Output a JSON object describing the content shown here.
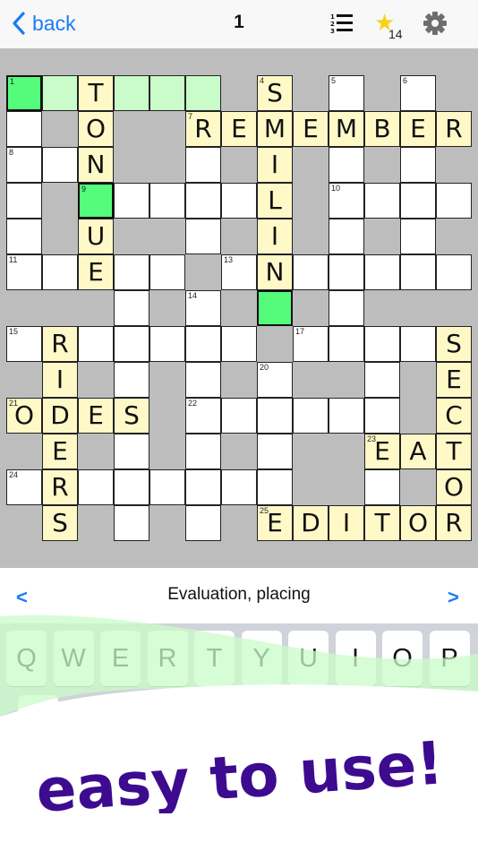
{
  "topbar": {
    "back_label": "back",
    "puzzle_number": "1",
    "star_count": "14",
    "icons": {
      "back": "chevron-left-icon",
      "clue_list": "numbered-list-icon",
      "star": "star-icon",
      "settings": "gear-icon"
    }
  },
  "colors": {
    "accent": "#1a7cf5",
    "board_bg": "#bdbdbd",
    "filled_cell": "#fff9c8",
    "selected_word": "#c9fcc8",
    "active_cell": "#55fc7c",
    "star": "#f7d21a",
    "tagline": "#3d0b8f"
  },
  "grid": {
    "rows": 13,
    "cols": 13,
    "legend": {
      "#": "block",
      ".": "empty",
      "g": "selected-word-empty",
      "G": "active-cell",
      "A-Z": "filled-letter"
    },
    "layout": [
      "GgTggg#S#.#.#",
      ".#O##REMEMBER",
      "..N##.#I#.#.#",
      ".#G....L#....",
      ".#U##.#I#.#.#",
      "..E..#.N.....",
      "###.#.#G#.###",
      ".R.....#....S",
      "#I#.#.#.##.#E",
      "ODES#......#C",
      "#E#.#.#.##EAT",
      ".R......##.#O",
      "#S#.#.#EDITOR"
    ],
    "numbers": [
      {
        "n": "1",
        "r": 0,
        "c": 0
      },
      {
        "n": "4",
        "r": 0,
        "c": 7
      },
      {
        "n": "5",
        "r": 0,
        "c": 9
      },
      {
        "n": "6",
        "r": 0,
        "c": 11
      },
      {
        "n": "7",
        "r": 1,
        "c": 5
      },
      {
        "n": "8",
        "r": 2,
        "c": 0
      },
      {
        "n": "9",
        "r": 3,
        "c": 2
      },
      {
        "n": "10",
        "r": 3,
        "c": 9
      },
      {
        "n": "11",
        "r": 5,
        "c": 0
      },
      {
        "n": "13",
        "r": 5,
        "c": 6
      },
      {
        "n": "14",
        "r": 6,
        "c": 5
      },
      {
        "n": "15",
        "r": 7,
        "c": 0
      },
      {
        "n": "17",
        "r": 7,
        "c": 8
      },
      {
        "n": "20",
        "r": 8,
        "c": 7
      },
      {
        "n": "21",
        "r": 9,
        "c": 0
      },
      {
        "n": "22",
        "r": 9,
        "c": 5
      },
      {
        "n": "23",
        "r": 10,
        "c": 10
      },
      {
        "n": "24",
        "r": 11,
        "c": 0
      },
      {
        "n": "25",
        "r": 12,
        "c": 7
      }
    ]
  },
  "clue_bar": {
    "prev_label": "<",
    "next_label": ">",
    "clue_text": "Evaluation, placing"
  },
  "keyboard": {
    "row1": [
      "Q",
      "W",
      "E",
      "R",
      "T",
      "Y",
      "U",
      "I",
      "O",
      "P"
    ]
  },
  "tagline": "easy to use!"
}
